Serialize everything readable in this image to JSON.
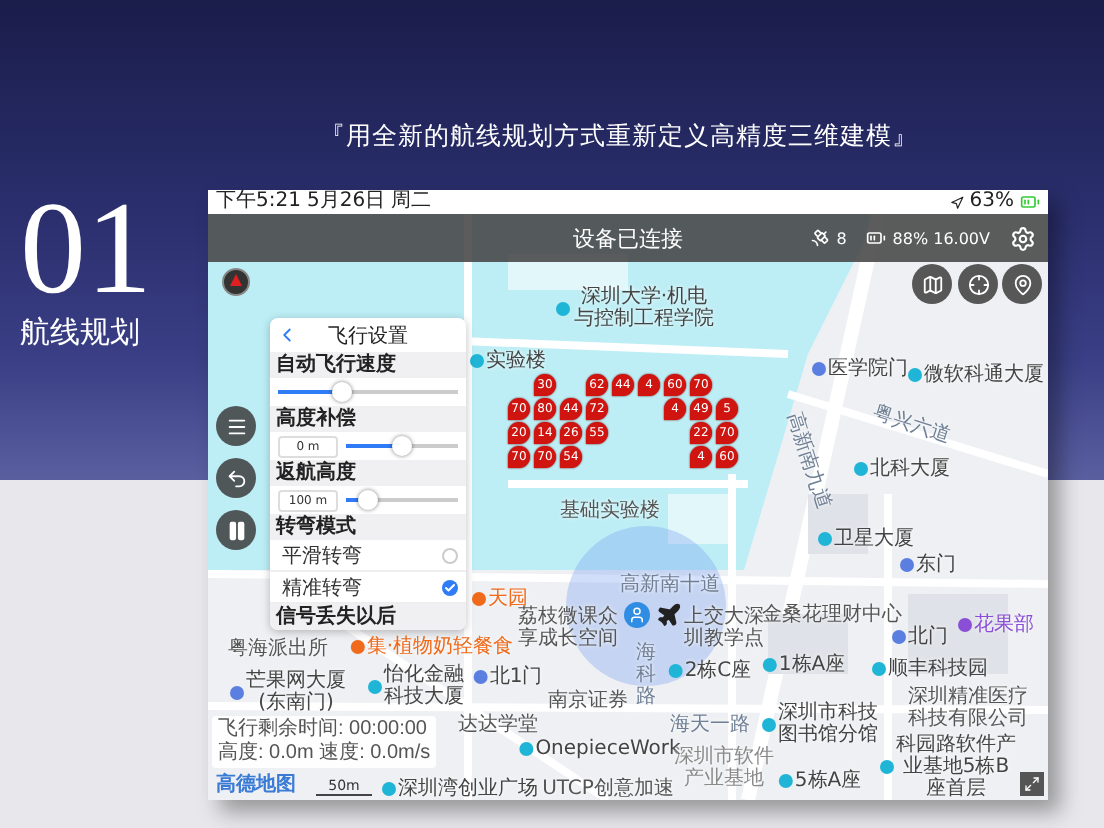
{
  "headline": "『用全新的航线规划方式重新定义高精度三维建模』",
  "section": {
    "number": "01",
    "title": "航线规划"
  },
  "status_bar": {
    "time": "下午5:21",
    "date": "5月26日 周二",
    "battery": "63%"
  },
  "top_bar": {
    "title": "设备已连接",
    "satellites": "8",
    "battery": "88% 16.00V"
  },
  "settings_panel": {
    "title": "飞行设置",
    "rows": [
      {
        "kind": "header",
        "label": "自动飞行速度"
      },
      {
        "kind": "slider",
        "level": 0.35
      },
      {
        "kind": "header",
        "label": "高度补偿"
      },
      {
        "kind": "slider",
        "value": "0 m",
        "level": 0.5
      },
      {
        "kind": "header",
        "label": "返航高度"
      },
      {
        "kind": "slider",
        "value": "100 m",
        "level": 0.2
      },
      {
        "kind": "header",
        "label": "转弯模式"
      },
      {
        "kind": "option",
        "label": "平滑转弯",
        "selected": false
      },
      {
        "kind": "option",
        "label": "精准转弯",
        "selected": true
      },
      {
        "kind": "header",
        "label": "信号丢失以后"
      }
    ]
  },
  "flight_info": {
    "lines": [
      "飞行剩余时间: 00:00:00",
      "高度: 0.0m  速度: 0.0m/s"
    ]
  },
  "map": {
    "provider": "高德地图",
    "scale": "50m",
    "labels": [
      {
        "text": "深圳大学·机电与控制工程学院",
        "kind": "poi"
      },
      {
        "text": "实验楼",
        "kind": "poi"
      },
      {
        "text": "医学院门",
        "kind": "gate"
      },
      {
        "text": "微软科通大厦",
        "kind": "poi"
      },
      {
        "text": "粤兴六道",
        "kind": "road"
      },
      {
        "text": "高新南九道",
        "kind": "road"
      },
      {
        "text": "北科大厦",
        "kind": "poi"
      },
      {
        "text": "基础实验楼",
        "kind": "place"
      },
      {
        "text": "卫星大厦",
        "kind": "poi"
      },
      {
        "text": "东门",
        "kind": "gate"
      },
      {
        "text": "天园",
        "kind": "restaurant"
      },
      {
        "text": "高新南十道",
        "kind": "road"
      },
      {
        "text": "荔枝微课众享成长空间",
        "kind": "place"
      },
      {
        "text": "上交大深圳教学点",
        "kind": "place"
      },
      {
        "text": "金桑花理财中心",
        "kind": "place"
      },
      {
        "text": "北门",
        "kind": "gate"
      },
      {
        "text": "花果部",
        "kind": "shop"
      },
      {
        "text": "海科路",
        "kind": "road_vertical"
      },
      {
        "text": "2栋C座",
        "kind": "poi"
      },
      {
        "text": "1栋A座",
        "kind": "poi"
      },
      {
        "text": "顺丰科技园",
        "kind": "poi"
      },
      {
        "text": "粤海派出所",
        "kind": "place"
      },
      {
        "text": "集·植物奶轻餐食",
        "kind": "restaurant"
      },
      {
        "text": "芒果网大厦(东南门)",
        "kind": "gate"
      },
      {
        "text": "怡化金融科技大厦",
        "kind": "poi"
      },
      {
        "text": "北1门",
        "kind": "gate"
      },
      {
        "text": "南京证券",
        "kind": "place"
      },
      {
        "text": "达达学堂",
        "kind": "place"
      },
      {
        "text": "海天一路",
        "kind": "road"
      },
      {
        "text": "深圳市科技图书馆分馆",
        "kind": "poi"
      },
      {
        "text": "深圳精准医疗科技有限公司",
        "kind": "place"
      },
      {
        "text": "深圳湾创业广场",
        "kind": "poi"
      },
      {
        "text": "OnepieceWork",
        "kind": "poi"
      },
      {
        "text": "UTCP创意加速",
        "kind": "place"
      },
      {
        "text": "深圳市软件产业基地",
        "kind": "area"
      },
      {
        "text": "5栋A座",
        "kind": "poi"
      },
      {
        "text": "科园路软件产业基地5栋B座首层",
        "kind": "poi"
      }
    ],
    "waypoints": [
      "30",
      "62",
      "44",
      "4",
      "60",
      "70",
      "70",
      "80",
      "44",
      "72",
      "4",
      "49",
      "5",
      "20",
      "14",
      "26",
      "55",
      "22",
      "70",
      "70",
      "70",
      "54",
      "4",
      "60"
    ]
  }
}
